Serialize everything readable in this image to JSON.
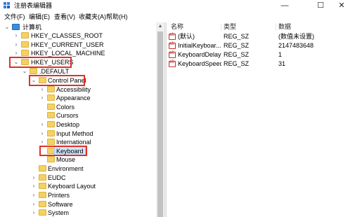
{
  "window": {
    "title": "注册表编辑器",
    "minimize": "—",
    "maximize": "☐",
    "close": "✕"
  },
  "menu": {
    "file": "文件(F)",
    "edit": "编辑(E)",
    "view": "查看(V)",
    "favorites": "收藏夹(A)",
    "help": "帮助(H)"
  },
  "tree": {
    "root": "计算机",
    "hives": {
      "classes_root": "HKEY_CLASSES_ROOT",
      "current_user": "HKEY_CURRENT_USER",
      "local_machine": "HKEY_LOCAL_MACHINE",
      "users": "HKEY_USERS"
    },
    "default": ".DEFAULT",
    "control_panel": "Control Panel",
    "control_panel_children": [
      "Accessibility",
      "Appearance",
      "Colors",
      "Cursors",
      "Desktop",
      "Input Method",
      "International",
      "Keyboard",
      "Mouse"
    ],
    "default_children": [
      "Environment",
      "EUDC",
      "Keyboard Layout",
      "Printers",
      "Software",
      "System"
    ],
    "selected": "Keyboard"
  },
  "list": {
    "columns": {
      "name": "名称",
      "type": "类型",
      "data": "数据"
    },
    "rows": [
      {
        "name": "(默认)",
        "type": "REG_SZ",
        "data": "(数值未设置)"
      },
      {
        "name": "InitialKeyboar...",
        "type": "REG_SZ",
        "data": "2147483648"
      },
      {
        "name": "KeyboardDelay",
        "type": "REG_SZ",
        "data": "1"
      },
      {
        "name": "KeyboardSpeed",
        "type": "REG_SZ",
        "data": "31"
      }
    ]
  },
  "icons": {
    "app": "registry-editor-icon",
    "folder": "folder-icon",
    "computer": "computer-icon",
    "string_value": "string-value-icon"
  },
  "colors": {
    "highlight_box": "#e0302a",
    "folder": "#f4d162",
    "selection": "#cce8ff"
  }
}
